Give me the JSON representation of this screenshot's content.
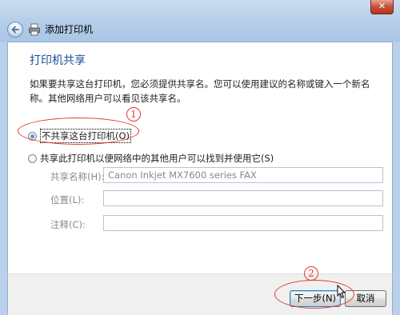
{
  "window": {
    "title": "添加打印机",
    "close_glyph": "✕"
  },
  "page": {
    "heading": "打印机共享",
    "description": "如果要共享这台打印机，您必须提供共享名。您可以使用建议的名称或键入一个新名称。其他网络用户可以看见该共享名。"
  },
  "options": {
    "no_share": {
      "label": "不共享这台打印机(O)",
      "checked": true
    },
    "share": {
      "label": "共享此打印机以便网络中的其他用户可以找到并使用它(S)",
      "checked": false
    }
  },
  "fields": {
    "share_name": {
      "label": "共享名称(H):",
      "value": "Canon Inkjet MX7600 series FAX"
    },
    "location": {
      "label": "位置(L):",
      "value": ""
    },
    "comment": {
      "label": "注释(C):",
      "value": ""
    }
  },
  "buttons": {
    "next": "下一步(N)",
    "cancel": "取消"
  },
  "annotations": {
    "step1": "1",
    "step2": "2",
    "color": "#e23a2a"
  },
  "icons": {
    "back": "back-arrow-icon",
    "printer": "printer-icon",
    "close": "close-icon",
    "cursor": "mouse-pointer-icon"
  }
}
